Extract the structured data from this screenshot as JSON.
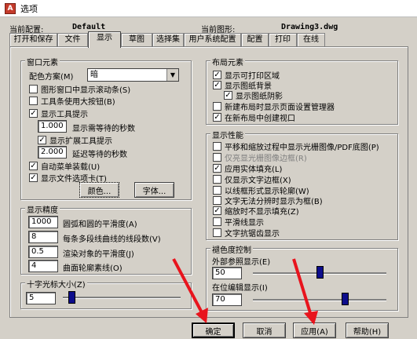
{
  "window": {
    "title": "选项"
  },
  "header": {
    "current_profile_label": "当前配置:",
    "current_profile_value": "Default",
    "current_drawing_label": "当前图形:",
    "current_drawing_value": "Drawing3.dwg"
  },
  "tabs": [
    "打开和保存",
    "文件",
    "显示",
    "草图",
    "选择集",
    "用户系统配置",
    "配置",
    "打印",
    "在线"
  ],
  "active_tab": "显示",
  "window_elements": {
    "title": "窗口元素",
    "color_scheme_label": "配色方案(M)",
    "color_scheme_value": "暗",
    "show_scrollbars": "图形窗口中显示滚动条(S)",
    "large_buttons": "工具条使用大按钮(B)",
    "show_tooltips": "显示工具提示",
    "tooltip_delay_value": "1.000",
    "tooltip_delay_label": "显示需等待的秒数",
    "show_extended_tooltips": "显示扩展工具提示",
    "extended_delay_value": "2.000",
    "extended_delay_label": "延迟等待的秒数",
    "auto_menu_load": "自动菜单装载(U)",
    "show_file_tabs": "显示文件选项卡(T)",
    "colors_button": "颜色...",
    "fonts_button": "字体..."
  },
  "display_precision": {
    "title": "显示精度",
    "arc_smoothness_value": "1000",
    "arc_smoothness_label": "圆弧和圆的平滑度(A)",
    "polyline_segments_value": "8",
    "polyline_segments_label": "每条多段线曲线的线段数(V)",
    "render_smoothness_value": "0.5",
    "render_smoothness_label": "渲染对象的平滑度(J)",
    "contour_lines_value": "4",
    "contour_lines_label": "曲面轮廓素线(O)"
  },
  "crosshair": {
    "title": "十字光标大小(Z)",
    "value": "5",
    "slider_fraction": 0.05
  },
  "layout_elements": {
    "title": "布局元素",
    "show_printable_area": "显示可打印区域",
    "show_paper_background": "显示图纸背景",
    "show_paper_shadow": "显示图纸阴影",
    "page_setup_manager": "新建布局时显示页面设置管理器",
    "create_viewport": "在新布局中创建视口"
  },
  "display_performance": {
    "title": "显示性能",
    "pan_zoom_raster": "平移和缩放过程中显示光栅图像/PDF底图(P)",
    "highlight_raster_frame": "仅亮显光栅图像边框(R)",
    "apply_solid_fill": "应用实体填充(L)",
    "text_frame_only": "仅显示文字边框(X)",
    "wireframe_silhouettes": "以线框形式显示轮廓(W)",
    "show_text_frame_when_unable": "文字无法分辨时显示为框(B)",
    "no_fill_when_zoom": "缩放时不显示填充(Z)",
    "smooth_lines": "平滑线显示",
    "text_antialias": "文字抗锯齿显示"
  },
  "fade_control": {
    "title": "褪色度控制",
    "xref_label": "外部参照显示(E)",
    "xref_value": "50",
    "xref_fraction": 0.5,
    "inplace_label": "在位编辑显示(I)",
    "inplace_value": "70",
    "inplace_fraction": 0.7
  },
  "buttons": {
    "ok": "确定",
    "cancel": "取消",
    "apply": "应用(A)",
    "help": "帮助(H)"
  },
  "colors": {
    "annotation_arrow": "#e8141d",
    "slider_thumb": "#0d0d8c"
  }
}
